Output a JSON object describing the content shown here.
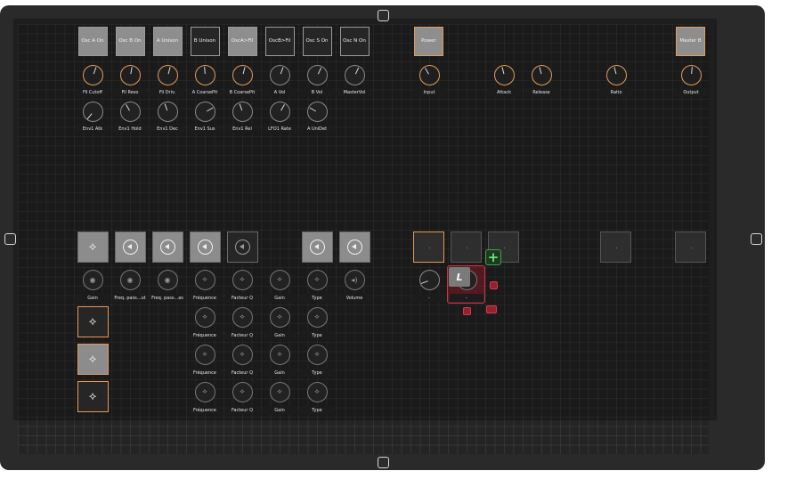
{
  "osc_buttons": [
    {
      "label": "Osc A On",
      "on": true
    },
    {
      "label": "Osc B On",
      "on": true
    },
    {
      "label": "A Unison",
      "on": true
    },
    {
      "label": "B Unison",
      "on": false
    },
    {
      "label": "OscA>Fil",
      "on": true
    },
    {
      "label": "OscB>Fil",
      "on": false
    },
    {
      "label": "Osc S On",
      "on": false
    },
    {
      "label": "Osc N On",
      "on": false
    }
  ],
  "power": {
    "label": "Power"
  },
  "master_bypass": {
    "label": "Master B"
  },
  "knob_row1": [
    "Fil Cutoff",
    "Fil Reso",
    "Fil Driv.",
    "A CoarsePit",
    "B CoarsePit",
    "A Vol",
    "B Vol",
    "MasterVol"
  ],
  "knob_row2": [
    "Env1 Atk",
    "Env1 Hold",
    "Env1 Dec",
    "Env1 Sus",
    "Env1 Rel",
    "LFO1 Rate",
    "A UniDet"
  ],
  "dynamics_knobs": [
    "Input",
    "Attack",
    "Release",
    "Ratio",
    "Output"
  ],
  "eq_knobs": [
    "Gain",
    "Freq. pass...ut",
    "Freq. pass...as",
    "Fréquence",
    "Facteur Q",
    "Gain",
    "Type",
    "Volume"
  ],
  "eq_band_labels": [
    "Fréquence",
    "Facteur Q",
    "Gain",
    "Type"
  ],
  "dash_label": "-",
  "drag_icon": "lasso-icon",
  "add_icon": "plus-icon",
  "colors": {
    "accent_orange": "#e59a56",
    "selection_red": "#c23a4a",
    "add_green": "#3da34a"
  }
}
